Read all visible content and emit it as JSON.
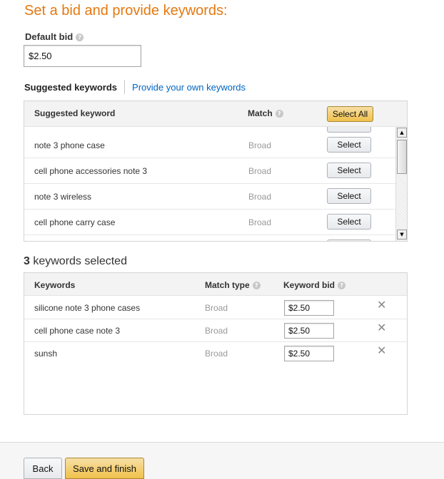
{
  "page": {
    "title": "Set a bid and provide keywords:"
  },
  "default_bid": {
    "label": "Default bid",
    "value": "$2.50",
    "help_icon": "help-icon"
  },
  "tabs": {
    "suggested": "Suggested keywords",
    "own": "Provide your own keywords"
  },
  "suggested_table": {
    "headers": {
      "keyword": "Suggested keyword",
      "match": "Match"
    },
    "select_all_label": "Select All",
    "rows": [
      {
        "keyword": "note 3 phone case",
        "match": "Broad",
        "button": "Select"
      },
      {
        "keyword": "cell phone accessories note 3",
        "match": "Broad",
        "button": "Select"
      },
      {
        "keyword": "note 3 wireless",
        "match": "Broad",
        "button": "Select"
      },
      {
        "keyword": "cell phone carry case",
        "match": "Broad",
        "button": "Select"
      }
    ],
    "scroll_up": "▲",
    "scroll_down": "▼"
  },
  "selected": {
    "count": "3",
    "count_suffix": " keywords selected",
    "headers": {
      "keywords": "Keywords",
      "match_type": "Match type",
      "keyword_bid": "Keyword bid"
    },
    "rows": [
      {
        "keyword": "silicone note 3 phone cases",
        "match": "Broad",
        "bid": "$2.50"
      },
      {
        "keyword": "cell phone case note 3",
        "match": "Broad",
        "bid": "$2.50"
      },
      {
        "keyword": "sunsh",
        "match": "Broad",
        "bid": "$2.50"
      }
    ],
    "remove_glyph": "✕"
  },
  "footer": {
    "back_label": "Back",
    "save_label": "Save and finish"
  },
  "colors": {
    "title": "#e47911",
    "link": "#0066c0",
    "primary_button": "#f0c14b"
  }
}
